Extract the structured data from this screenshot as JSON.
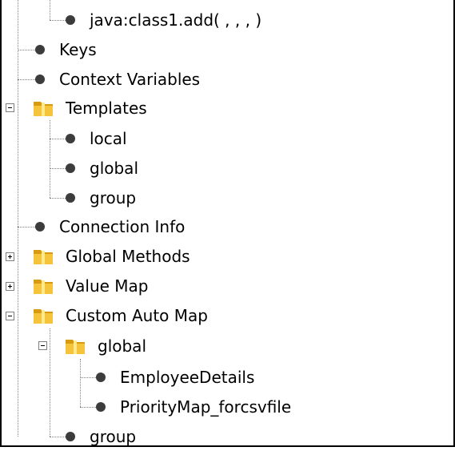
{
  "tree": {
    "items": [
      {
        "label": "java:class1.add( , , ,  )",
        "icon": "bullet-icon"
      },
      {
        "label": "Keys",
        "icon": "bullet-icon"
      },
      {
        "label": "Context Variables",
        "icon": "bullet-icon"
      },
      {
        "label": "Templates",
        "icon": "folder-icon",
        "expanded": true
      },
      {
        "label": "local",
        "icon": "bullet-icon"
      },
      {
        "label": "global",
        "icon": "bullet-icon"
      },
      {
        "label": "group",
        "icon": "bullet-icon"
      },
      {
        "label": "Connection Info",
        "icon": "bullet-icon"
      },
      {
        "label": "Global Methods",
        "icon": "folder-icon",
        "expanded": false
      },
      {
        "label": "Value Map",
        "icon": "folder-icon",
        "expanded": false
      },
      {
        "label": "Custom Auto Map",
        "icon": "folder-icon",
        "expanded": true
      },
      {
        "label": "global",
        "icon": "folder-icon",
        "expanded": true
      },
      {
        "label": "EmployeeDetails",
        "icon": "bullet-icon"
      },
      {
        "label": "PriorityMap_forcsvfile",
        "icon": "bullet-icon"
      },
      {
        "label": "group",
        "icon": "bullet-icon"
      }
    ]
  },
  "colors": {
    "folder": "#f0c020",
    "bullet": "#3c3c3c",
    "connector": "#808080",
    "border": "#000000"
  }
}
